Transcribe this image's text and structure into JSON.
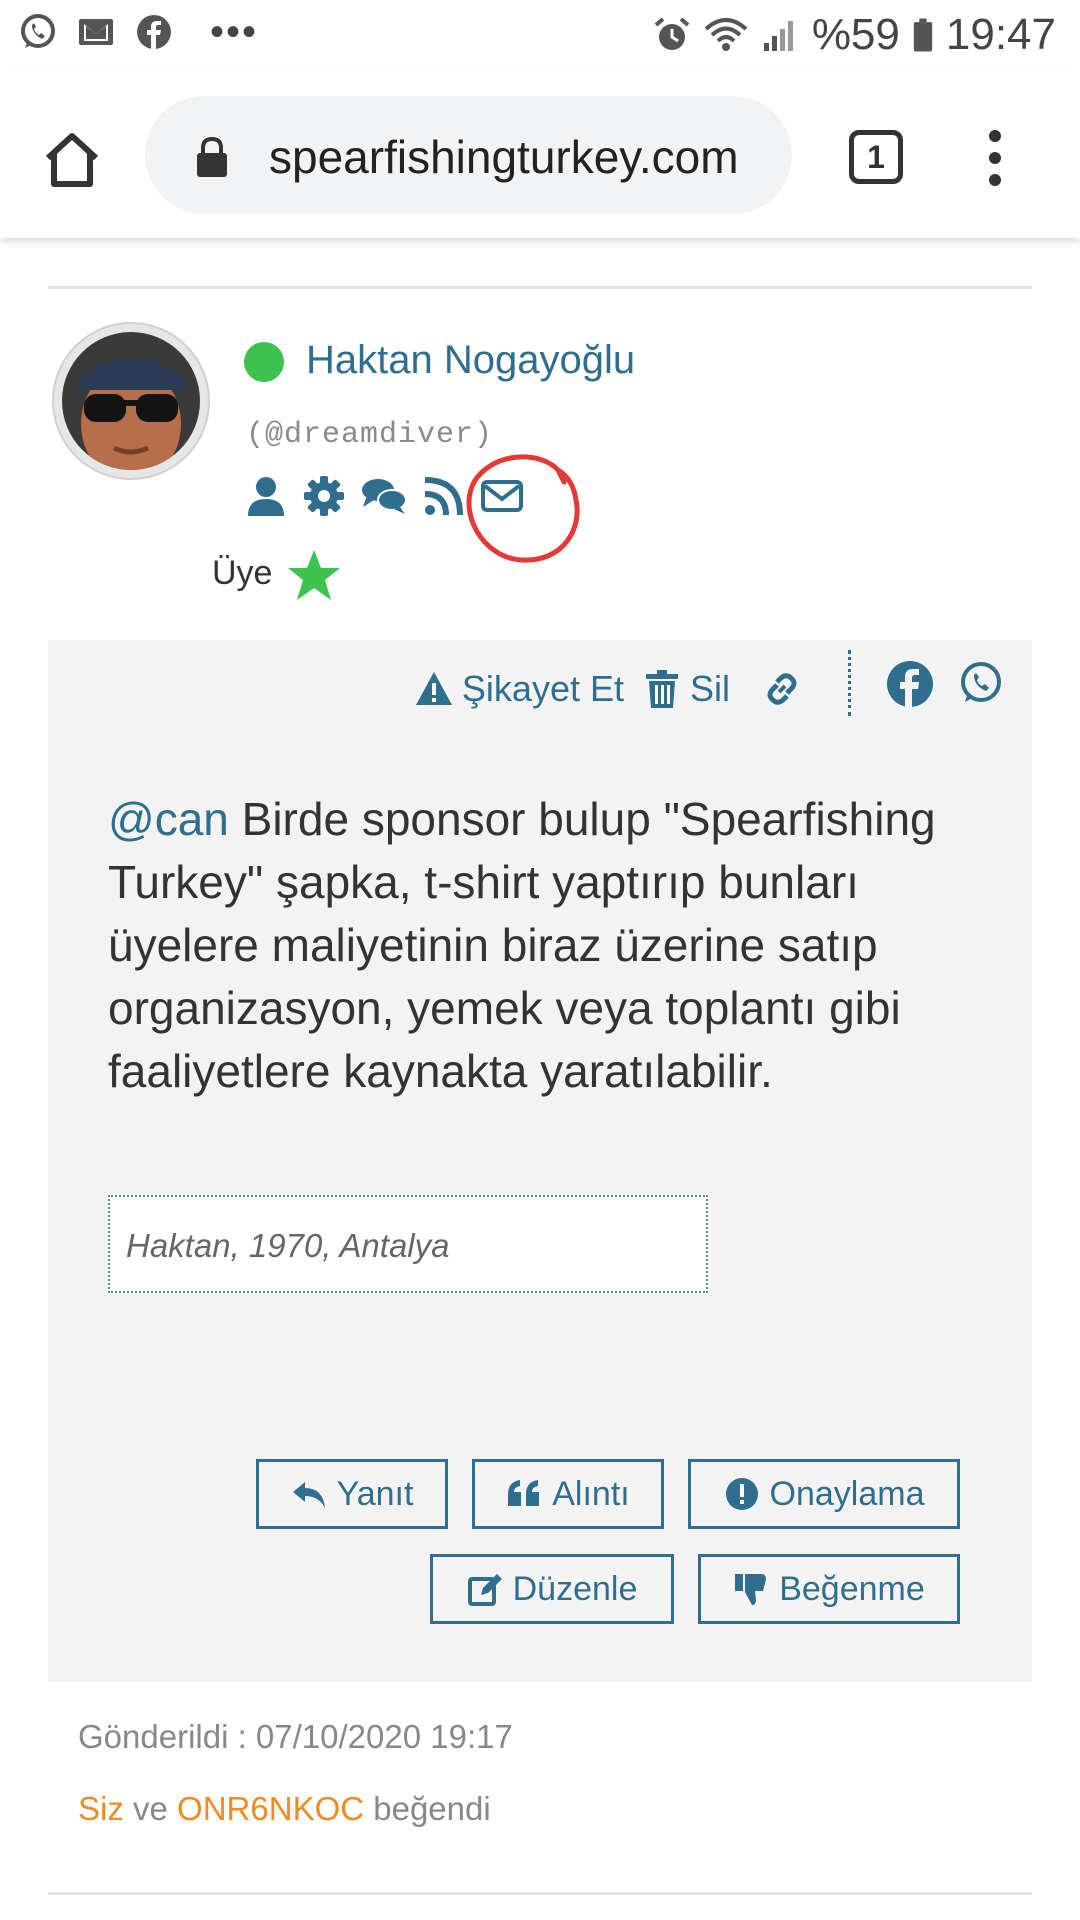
{
  "status_bar": {
    "battery": "%59",
    "time": "19:47",
    "notification_icons": [
      "whatsapp-icon",
      "gmail-icon",
      "facebook-icon"
    ],
    "more_indicator": "•••"
  },
  "browser": {
    "url": "spearfishingturkey.com",
    "tab_count": "1"
  },
  "author": {
    "name": "Haktan Nogayoğlu",
    "handle": "(@dreamdiver)",
    "rank": "Üye",
    "online_color": "#3cc24f"
  },
  "post": {
    "actions": {
      "report": "Şikayet Et",
      "delete": "Sil"
    },
    "mention": "@can",
    "body": " Birde sponsor bulup \"Spearfishing Turkey\" şapka, t-shirt yaptırıp bunları üyelere maliyetinin biraz üzerine satıp organizasyon, yemek veya toplantı gibi faaliyetlere kaynakta yaratılabilir.",
    "signature": "Haktan, 1970, Antalya",
    "buttons": {
      "reply": "Yanıt",
      "quote": "Alıntı",
      "approve": "Onaylama",
      "edit": "Düzenle",
      "dislike": "Beğenme"
    }
  },
  "meta": {
    "sent": "Gönderildi : 07/10/2020 19:17",
    "liker_1": "Siz",
    "conjunction": " ve ",
    "liker_2": "ONR6NKOC",
    "liked_suffix": " beğendi"
  },
  "colors": {
    "accent": "#2f6e8e",
    "highlight": "#f08a24",
    "annotation": "#e53935"
  }
}
